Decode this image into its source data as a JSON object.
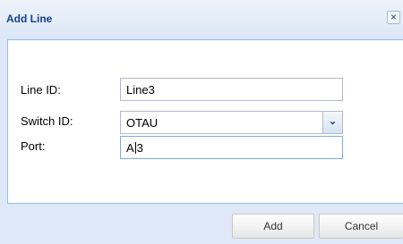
{
  "dialog": {
    "title": "Add Line",
    "close_symbol": "×",
    "close_icon": "close-icon"
  },
  "form": {
    "line_id": {
      "label": "Line ID:",
      "value": "Line3"
    },
    "switch_id": {
      "label": "Switch ID:",
      "value": "OTAU",
      "dropdown_symbol": "⌄",
      "dropdown_icon": "chevron-down-icon"
    },
    "port": {
      "label": "Port:",
      "value_before_cursor": "A",
      "value_after_cursor": "3"
    }
  },
  "buttons": {
    "add": "Add",
    "cancel": "Cancel"
  },
  "colors": {
    "title": "#15428b",
    "window_bg": "#dfe8f6",
    "focus_border": "#7eadd9"
  }
}
